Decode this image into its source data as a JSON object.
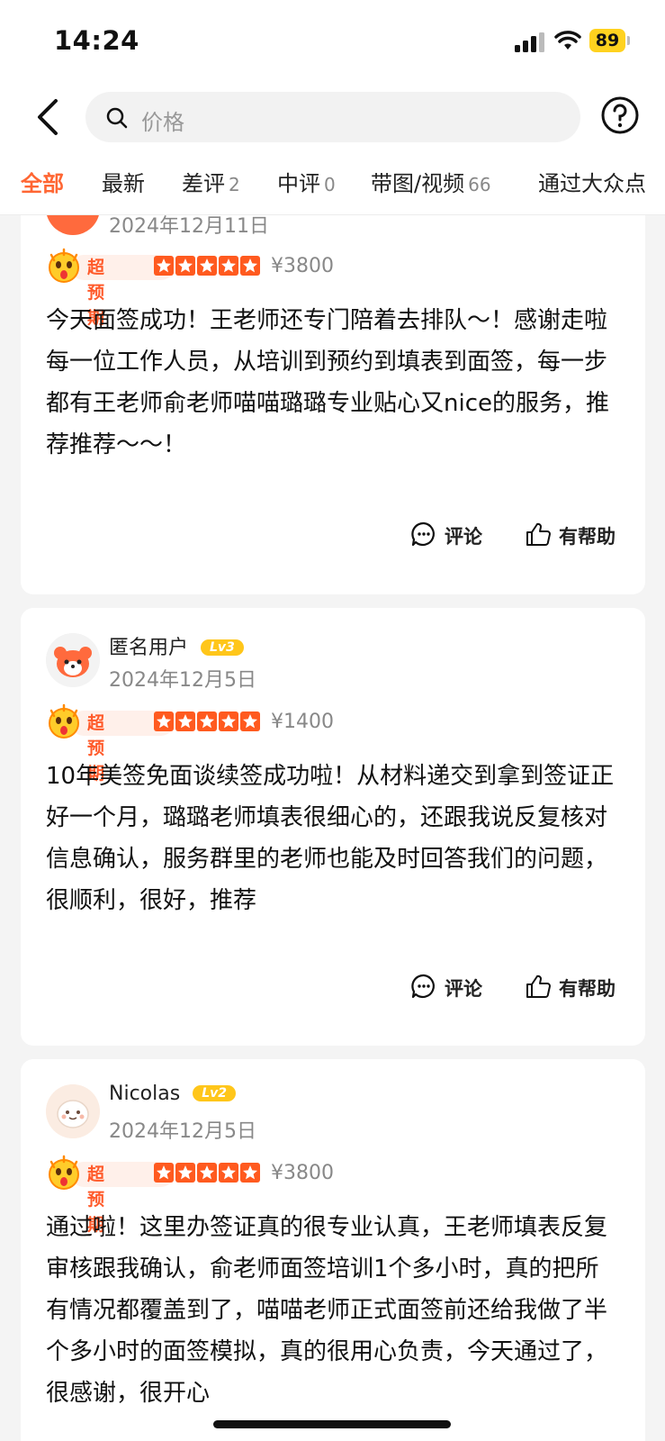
{
  "status_bar": {
    "time": "14:24",
    "battery": "89"
  },
  "search": {
    "placeholder": "价格"
  },
  "tabs": [
    {
      "label": "全部",
      "count": ""
    },
    {
      "label": "最新",
      "count": ""
    },
    {
      "label": "差评",
      "count": "2"
    },
    {
      "label": "中评",
      "count": "0"
    },
    {
      "label": "带图/视频",
      "count": "66"
    },
    {
      "label": "通过大众点",
      "count": ""
    }
  ],
  "reviews": [
    {
      "user": "",
      "level": "",
      "date": "2024年12月11日",
      "tag": "超预期",
      "rating": 5,
      "price": "¥3800",
      "content": "今天面签成功！王老师还专门陪着去排队～！感谢走啦每一位工作人员，从培训到预约到填表到面签，每一步都有王老师俞老师喵喵璐璐专业贴心又nice的服务，推荐推荐～～！",
      "comment_label": "评论",
      "helpful_label": "有帮助"
    },
    {
      "user": "匿名用户",
      "level": "Lv3",
      "date": "2024年12月5日",
      "tag": "超预期",
      "rating": 5,
      "price": "¥1400",
      "content": "10年美签免面谈续签成功啦！从材料递交到拿到签证正好一个月，璐璐老师填表很细心的，还跟我说反复核对信息确认，服务群里的老师也能及时回答我们的问题，很顺利，很好，推荐",
      "comment_label": "评论",
      "helpful_label": "有帮助"
    },
    {
      "user": "Nicolas",
      "level": "Lv2",
      "date": "2024年12月5日",
      "tag": "超预期",
      "rating": 5,
      "price": "¥3800",
      "content": "通过啦！这里办签证真的很专业认真，王老师填表反复审核跟我确认，俞老师面签培训1个多小时，真的把所有情况都覆盖到了，喵喵老师正式面签前还给我做了半个多小时的面签模拟，真的很用心负责，今天通过了，很感谢，很开心",
      "comment_label": "",
      "helpful_label": ""
    }
  ],
  "colors": {
    "accent": "#ff6633",
    "star": "#ff5a1f",
    "level_badge": "#ffc61a"
  }
}
